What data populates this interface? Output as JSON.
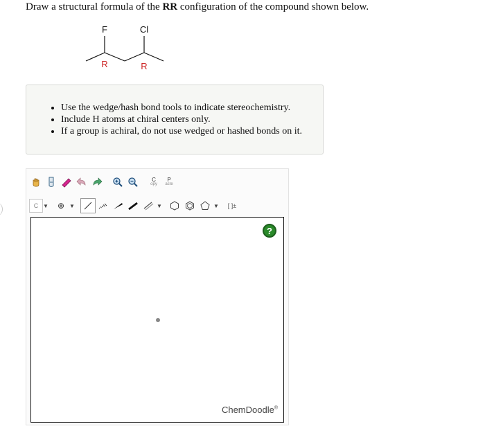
{
  "question": {
    "prefix": "Draw a structural formula of the ",
    "bold": "RR",
    "suffix": " configuration of the compound shown below."
  },
  "molecule": {
    "substituent_left": "F",
    "substituent_right": "Cl",
    "label_left": "R",
    "label_right": "R"
  },
  "instructions": [
    "Use the wedge/hash bond tools to indicate stereochemistry.",
    "Include H atoms at chiral centers only.",
    "If a group is achiral, do not use wedged or hashed bonds on it."
  ],
  "toolbar": {
    "copy_label_top": "C",
    "copy_label_bottom": "opy",
    "paste_label_top": "P",
    "paste_label_bottom": "aste",
    "element_label": "C",
    "charge_label": "⊕",
    "bracket_label": "[ ]±"
  },
  "canvas": {
    "help_label": "?",
    "brand": "ChemDoodle",
    "brand_mark": "®"
  }
}
